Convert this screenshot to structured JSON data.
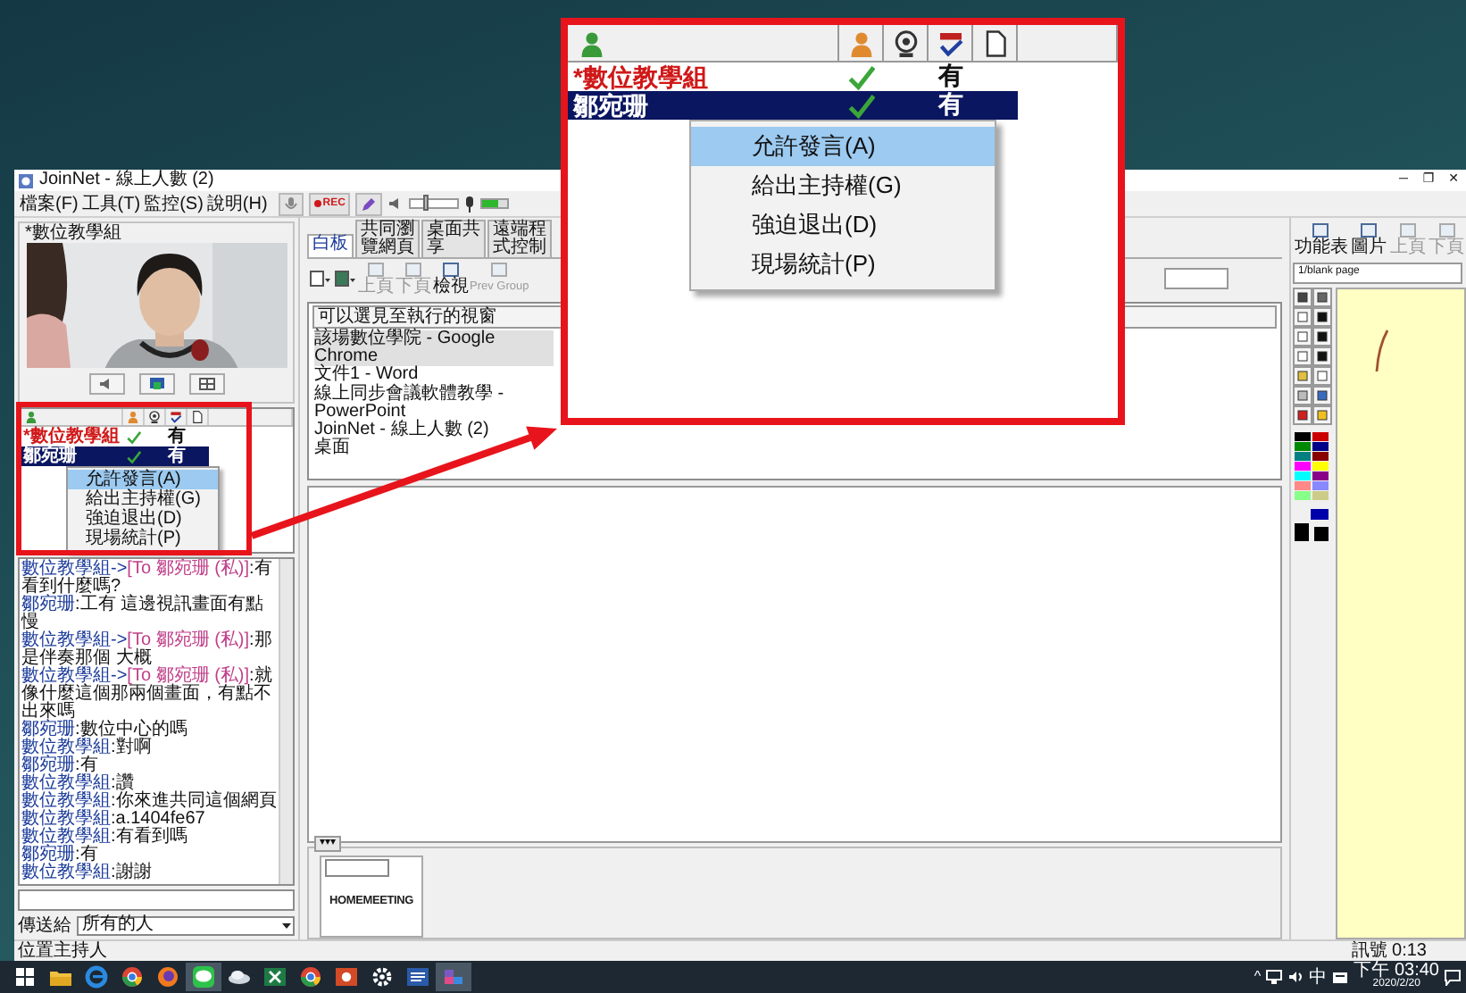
{
  "window": {
    "title": "JoinNet - 線上人數 (2)",
    "controls": [
      "─",
      "❐",
      "✕"
    ]
  },
  "menu": [
    {
      "label": "檔案(F)"
    },
    {
      "label": "工具(T)"
    },
    {
      "label": "監控(S)"
    },
    {
      "label": "說明(H)"
    }
  ],
  "toolbar": {
    "rec_label": "REC",
    "volume": {
      "level": 0.3
    },
    "mic_meter": {
      "level": 0.6
    }
  },
  "video_panel": {
    "title": "*數位教學組"
  },
  "user_list": {
    "rows": [
      {
        "name": "*數位教學組",
        "presenter": true,
        "video": true,
        "status": "有",
        "selected": false
      },
      {
        "name": "鄒宛珊",
        "presenter": false,
        "video": true,
        "status": "有",
        "selected": true
      }
    ],
    "context_menu": [
      {
        "label": "允許發言(A)",
        "selected": true
      },
      {
        "label": "給出主持權(G)",
        "selected": false
      },
      {
        "label": "強迫退出(D)",
        "selected": false
      },
      {
        "label": "現場統計(P)",
        "selected": false
      }
    ]
  },
  "chat": {
    "lines": [
      {
        "sender": "數位教學組->",
        "target": "[To 鄒宛珊 (私)]",
        "text": ":有看到什麼嗎?"
      },
      {
        "sender": "鄒宛珊",
        "text": ":工有 這邊視訊畫面有點慢"
      },
      {
        "sender": "數位教學組->",
        "target": "[To 鄒宛珊 (私)]",
        "text": ":那是伴奏那個 大概"
      },
      {
        "sender": "數位教學組->",
        "target": "[To 鄒宛珊 (私)]",
        "text": ":就像什麼這個那兩個畫面，有點不出來嗎"
      },
      {
        "sender": "鄒宛珊",
        "text": ":數位中心的嗎"
      },
      {
        "sender": "數位教學組",
        "text": ":對啊"
      },
      {
        "sender": "鄒宛珊",
        "text": ":有"
      },
      {
        "sender": "數位教學組",
        "text": ":讚"
      },
      {
        "sender": "數位教學組",
        "text": ":你來進共同這個網頁"
      },
      {
        "sender": "數位教學組",
        "text": ":a.1404fe67"
      },
      {
        "sender": "數位教學組",
        "text": ":有看到嗎"
      },
      {
        "sender": "鄒宛珊",
        "text": ":有"
      },
      {
        "sender": "數位教學組",
        "text": ":謝謝"
      }
    ]
  },
  "send_to": {
    "label": "傳送給",
    "value": "所有的人"
  },
  "tabs": [
    {
      "label": "白板",
      "selected": true
    },
    {
      "label": "共同瀏覽網頁",
      "selected": false
    },
    {
      "label": "桌面共享",
      "selected": false
    },
    {
      "label": "遠端程式控制",
      "selected": false
    }
  ],
  "share_toolbar": [
    {
      "label": "上頁",
      "disabled": true
    },
    {
      "label": "下頁",
      "disabled": true
    },
    {
      "label": "檢視",
      "disabled": false
    },
    {
      "label": "Prev Group",
      "disabled": true
    }
  ],
  "window_list": {
    "header": "可以選見至執行的視窗",
    "items": [
      {
        "label": "該場數位學院 - Google Chrome",
        "selected": true
      },
      {
        "label": "文件1 - Word",
        "selected": false
      },
      {
        "label": "線上同步會議軟體教學 - PowerPoint",
        "selected": false
      },
      {
        "label": "JoinNet - 線上人數 (2)",
        "selected": false
      },
      {
        "label": "桌面",
        "selected": false
      }
    ]
  },
  "thumbnail_strip": {
    "toggle": "▾▾▾",
    "logo": "HOMEMEETING"
  },
  "whiteboard": {
    "toolbar": [
      {
        "label": "功能表",
        "disabled": false
      },
      {
        "label": "圖片",
        "disabled": false
      },
      {
        "label": "上頁",
        "disabled": true
      },
      {
        "label": "下頁",
        "disabled": true
      }
    ],
    "page": "1/blank page"
  },
  "status_bar": {
    "left": "位置主持人",
    "right": "訊號 0:13"
  },
  "taskbar": {
    "apps": [
      {
        "kind": "start",
        "selected": false
      },
      {
        "kind": "explorer",
        "selected": false
      },
      {
        "kind": "edge",
        "selected": false
      },
      {
        "kind": "chrome",
        "selected": false
      },
      {
        "kind": "firefox",
        "selected": false
      },
      {
        "kind": "line",
        "selected": true
      },
      {
        "kind": "cloud",
        "selected": false
      },
      {
        "kind": "excel",
        "selected": false
      },
      {
        "kind": "chrome",
        "selected": false
      },
      {
        "kind": "powerpoint",
        "selected": false
      },
      {
        "kind": "settings",
        "selected": false
      },
      {
        "kind": "word",
        "selected": false
      },
      {
        "kind": "joinnet",
        "selected": true
      }
    ],
    "tray": {
      "chevron": "^",
      "ime": "中",
      "time": "下午 03:40",
      "date": "2020/2/20"
    }
  },
  "zoom_callout": {
    "rows": [
      {
        "name": "*數位教學組",
        "presenter": true,
        "video": true,
        "status": "有",
        "selected": false
      },
      {
        "name": "鄒宛珊",
        "presenter": false,
        "video": true,
        "status": "有",
        "selected": true
      }
    ],
    "context_menu": [
      {
        "label": "允許發言(A)",
        "selected": true
      },
      {
        "label": "給出主持權(G)",
        "selected": false
      },
      {
        "label": "強迫退出(D)",
        "selected": false
      },
      {
        "label": "現場統計(P)",
        "selected": false
      }
    ]
  }
}
